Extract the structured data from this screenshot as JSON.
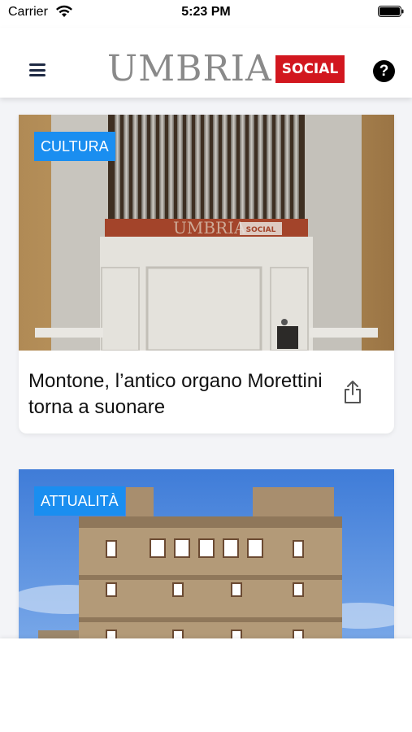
{
  "status_bar": {
    "carrier": "Carrier",
    "time": "5:23 PM"
  },
  "header": {
    "logo_word": "UMBRIA",
    "logo_badge": "SOCIAL",
    "help_label": "?"
  },
  "articles": [
    {
      "category": "CULTURA",
      "title": "Montone, l’antico organo Morettini torna a suonare",
      "watermark": "UMBRIA",
      "watermark_badge": "SOCIAL",
      "image": "church-organ"
    },
    {
      "category": "ATTUALITÀ",
      "title": "",
      "image": "stone-palace"
    }
  ],
  "icons": {
    "menu": "hamburger-menu-icon",
    "help": "question-circle-icon",
    "share": "share-icon",
    "wifi": "wifi-icon",
    "battery": "battery-icon"
  },
  "colors": {
    "accent": "#1a8ef0",
    "brand_red": "#d2171f",
    "background": "#f3f4f7"
  }
}
